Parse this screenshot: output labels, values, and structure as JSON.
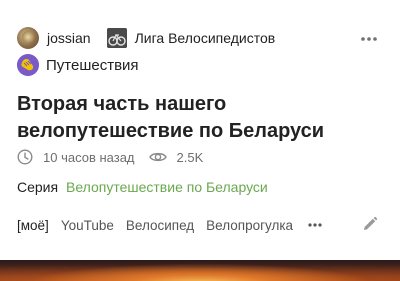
{
  "post": {
    "author": "jossian",
    "community": "Лига Велосипедистов",
    "tag_primary": "Путешествия",
    "title": "Вторая часть нашего велопутешествие по Беларуси",
    "time_ago": "10 часов назад",
    "views": "2.5K",
    "series_label": "Серия",
    "series_name": "Велопутешествие по Беларуси",
    "tags": [
      "[моё]",
      "YouTube",
      "Велосипед",
      "Велопрогулка"
    ]
  },
  "icons": {
    "time": "clock-icon",
    "views": "eye-icon",
    "more": "more-horizontal-icon",
    "edit": "pencil-icon"
  },
  "colors": {
    "series_link": "#6aa84f",
    "muted": "#6e6e6e",
    "text": "#222222",
    "tag_icon_bg": "#7a5ac8",
    "tag_icon_yellow": "#f2c200"
  }
}
